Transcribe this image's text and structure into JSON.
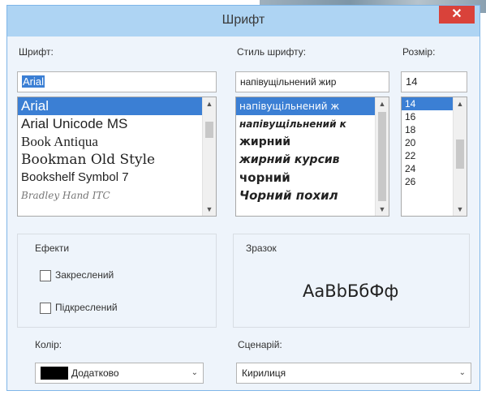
{
  "window": {
    "title": "Шрифт",
    "close_glyph": "✕"
  },
  "font": {
    "label": "Шрифт:",
    "value": "Arial",
    "items": [
      "Arial",
      "Arial Unicode MS",
      "Book Antiqua",
      "Bookman Old Style",
      "Bookshelf Symbol 7",
      "Bradley Hand ITC"
    ],
    "selected_index": 0
  },
  "style": {
    "label": "Стиль шрифту:",
    "value": "напівущільнений жир",
    "items": [
      "напівущільнений ж",
      "напівущільнений к",
      "жирний",
      "жирний курсив",
      "чорний",
      "Чорний похил"
    ],
    "selected_index": 0
  },
  "size": {
    "label": "Розмір:",
    "value": "14",
    "items": [
      "14",
      "16",
      "18",
      "20",
      "22",
      "24",
      "26"
    ],
    "selected_index": 0
  },
  "effects": {
    "label": "Ефекти",
    "strikeout_label": "Закреслений",
    "underline_label": "Підкреслений",
    "strikeout_checked": false,
    "underline_checked": false
  },
  "color": {
    "label": "Колір:",
    "value": "Додатково",
    "swatch_color": "#000000"
  },
  "sample": {
    "label": "Зразок",
    "text": "AaBbБбФф"
  },
  "script": {
    "label": "Сценарій:",
    "value": "Кирилиця"
  },
  "icons": {
    "scroll_up": "▲",
    "scroll_down": "▼",
    "dropdown": "⌄"
  },
  "colors": {
    "titlebar": "#aed4f3",
    "selection": "#3b7fd4",
    "close": "#d9423a"
  }
}
